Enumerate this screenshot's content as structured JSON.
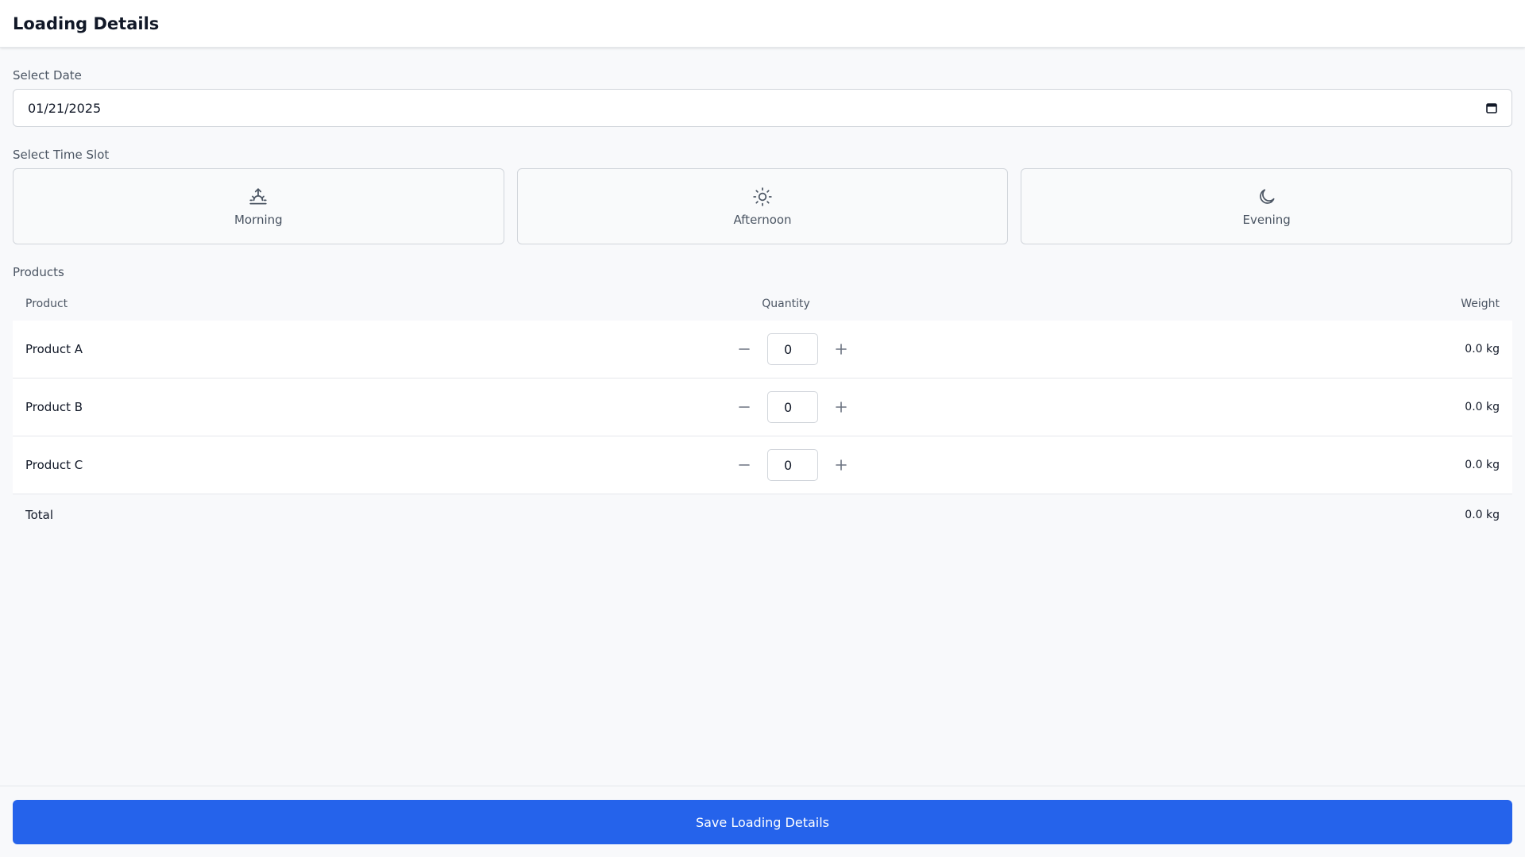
{
  "header": {
    "title": "Loading Details"
  },
  "date": {
    "label": "Select Date",
    "value": "01/21/2025",
    "icon": "calendar-icon"
  },
  "time_slot": {
    "label": "Select Time Slot",
    "options": [
      {
        "label": "Morning",
        "icon": "sunrise-icon"
      },
      {
        "label": "Afternoon",
        "icon": "sun-icon"
      },
      {
        "label": "Evening",
        "icon": "moon-icon"
      }
    ]
  },
  "products": {
    "label": "Products",
    "columns": {
      "product": "Product",
      "quantity": "Quantity",
      "weight": "Weight"
    },
    "rows": [
      {
        "name": "Product A",
        "quantity": "0",
        "weight": "0.0 kg"
      },
      {
        "name": "Product B",
        "quantity": "0",
        "weight": "0.0 kg"
      },
      {
        "name": "Product C",
        "quantity": "0",
        "weight": "0.0 kg"
      }
    ],
    "total": {
      "label": "Total",
      "weight": "0.0 kg"
    }
  },
  "footer": {
    "save_label": "Save Loading Details"
  },
  "colors": {
    "accent": "#2563eb",
    "border": "#d1d5db",
    "background": "#f8f9fb"
  }
}
